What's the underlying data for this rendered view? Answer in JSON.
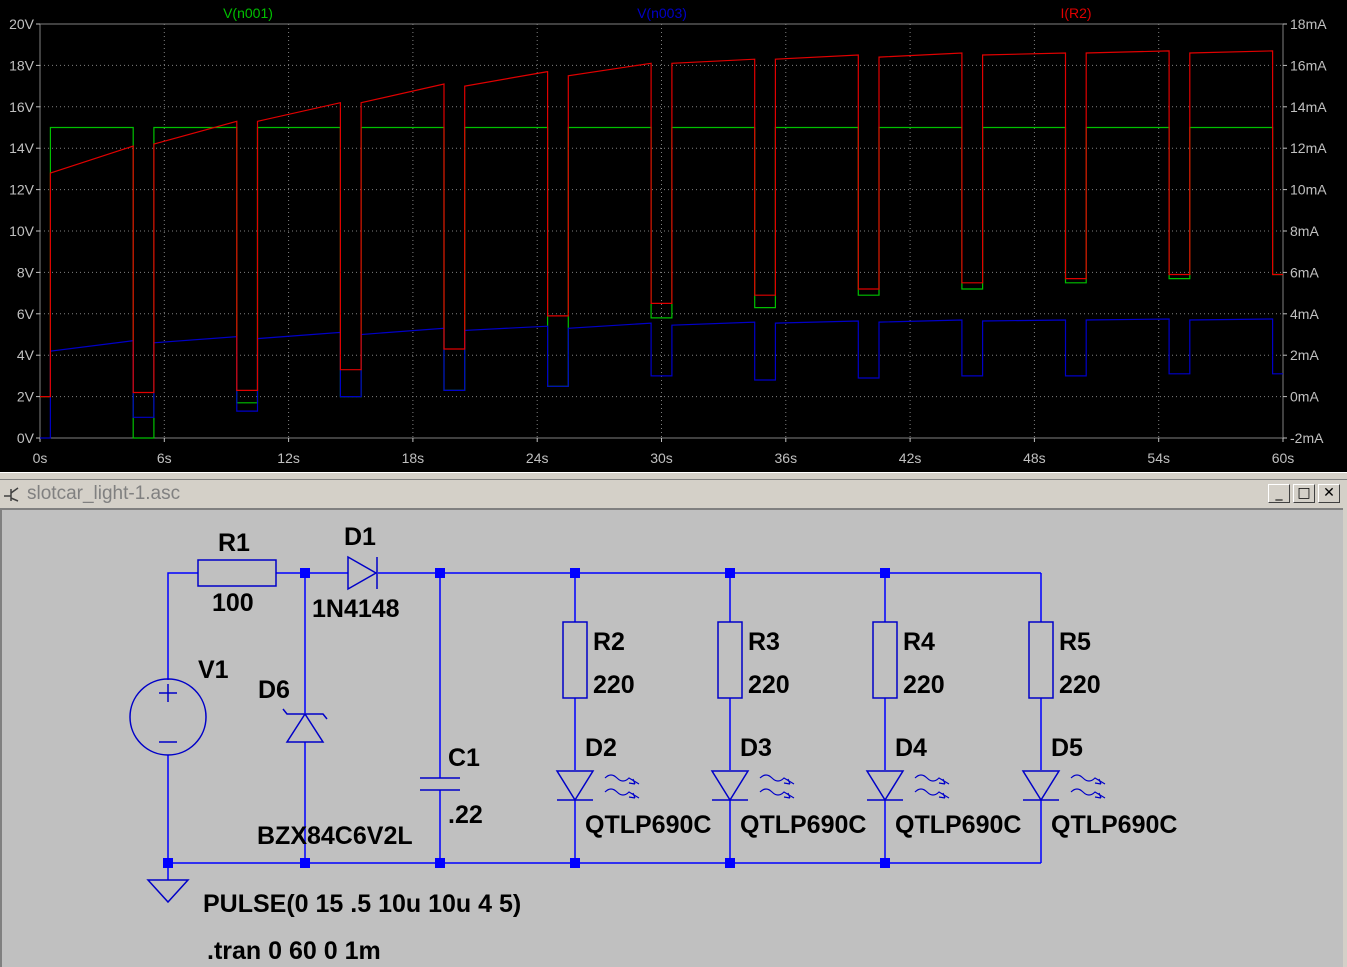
{
  "plot": {
    "traces": [
      {
        "name": "V(n001)",
        "color": "#00c000"
      },
      {
        "name": "V(n003)",
        "color": "#0000c8"
      },
      {
        "name": "I(R2)",
        "color": "#e00000"
      }
    ],
    "x_ticks": [
      "0s",
      "6s",
      "12s",
      "18s",
      "24s",
      "30s",
      "36s",
      "42s",
      "48s",
      "54s",
      "60s"
    ],
    "y_left_ticks": [
      "20V",
      "18V",
      "16V",
      "14V",
      "12V",
      "10V",
      "8V",
      "6V",
      "4V",
      "2V",
      "0V"
    ],
    "y_right_ticks": [
      "18mA",
      "16mA",
      "14mA",
      "12mA",
      "10mA",
      "8mA",
      "6mA",
      "4mA",
      "2mA",
      "0mA",
      "-2mA"
    ],
    "x_range": [
      0,
      60
    ],
    "y_left_range": [
      0,
      20
    ],
    "y_right_range": [
      -2,
      18
    ]
  },
  "chart_data": {
    "type": "line",
    "x_range": [
      0,
      60
    ],
    "ylim": [
      0,
      20
    ],
    "y2lim": [
      -2,
      18
    ],
    "pulse": {
      "v1": 0,
      "v2": 15,
      "delay": 0.5,
      "rise": 1e-05,
      "fall": 1e-05,
      "on": 4,
      "period": 5
    },
    "series": [
      {
        "name": "V(n001)",
        "axis": "left",
        "points": [
          [
            0,
            2
          ],
          [
            0.5,
            2
          ],
          [
            0.5,
            15
          ],
          [
            4.5,
            15
          ],
          [
            4.5,
            0
          ],
          [
            5.5,
            0
          ],
          [
            5.5,
            1
          ],
          [
            5.5,
            15
          ],
          [
            9.5,
            15
          ],
          [
            9.5,
            1.7
          ],
          [
            10.5,
            1.7
          ],
          [
            10.5,
            15
          ],
          [
            14.5,
            15
          ],
          [
            14.5,
            2
          ],
          [
            15.5,
            2
          ],
          [
            15.5,
            15
          ],
          [
            19.5,
            15
          ],
          [
            19.5,
            2.3
          ],
          [
            20.5,
            2.3
          ],
          [
            20.5,
            15
          ],
          [
            24.5,
            15
          ],
          [
            24.5,
            2.5
          ],
          [
            25.5,
            2.5
          ],
          [
            25.5,
            15
          ],
          [
            29.5,
            15
          ],
          [
            29.5,
            5.8
          ],
          [
            30.5,
            5.8
          ],
          [
            30.5,
            15
          ],
          [
            34.5,
            15
          ],
          [
            34.5,
            6.3
          ],
          [
            35.5,
            6.3
          ],
          [
            35.5,
            15
          ],
          [
            39.5,
            15
          ],
          [
            39.5,
            6.9
          ],
          [
            40.5,
            6.9
          ],
          [
            40.5,
            15
          ],
          [
            44.5,
            15
          ],
          [
            44.5,
            7.2
          ],
          [
            45.5,
            7.2
          ],
          [
            45.5,
            15
          ],
          [
            49.5,
            15
          ],
          [
            49.5,
            7.5
          ],
          [
            50.5,
            7.5
          ],
          [
            50.5,
            15
          ],
          [
            54.5,
            15
          ],
          [
            54.5,
            7.7
          ],
          [
            55.5,
            7.7
          ],
          [
            55.5,
            15
          ],
          [
            59.5,
            15
          ],
          [
            59.5,
            7.9
          ],
          [
            60,
            7.9
          ]
        ]
      },
      {
        "name": "V(n003)",
        "axis": "left",
        "points": [
          [
            0.5,
            4.2
          ],
          [
            4.5,
            4.7
          ],
          [
            5.5,
            4.6
          ],
          [
            9.5,
            4.9
          ],
          [
            10.5,
            4.8
          ],
          [
            14.5,
            5.1
          ],
          [
            15.5,
            5.0
          ],
          [
            19.5,
            5.3
          ],
          [
            20.5,
            5.2
          ],
          [
            24.5,
            5.4
          ],
          [
            25.5,
            5.3
          ],
          [
            29.5,
            5.55
          ],
          [
            30.5,
            5.45
          ],
          [
            34.5,
            5.6
          ],
          [
            35.5,
            5.55
          ],
          [
            39.5,
            5.65
          ],
          [
            40.5,
            5.6
          ],
          [
            44.5,
            5.7
          ],
          [
            45.5,
            5.65
          ],
          [
            49.5,
            5.7
          ],
          [
            50.5,
            5.7
          ],
          [
            54.5,
            5.75
          ],
          [
            55.5,
            5.7
          ],
          [
            59.5,
            5.75
          ]
        ]
      },
      {
        "name": "I(R2)",
        "axis": "right",
        "points": [
          [
            0.5,
            10.8
          ],
          [
            4.5,
            12.1
          ],
          [
            5.5,
            12.2
          ],
          [
            9.5,
            13.3
          ],
          [
            10.5,
            13.3
          ],
          [
            14.5,
            14.2
          ],
          [
            15.5,
            14.2
          ],
          [
            19.5,
            15.1
          ],
          [
            20.5,
            15.0
          ],
          [
            24.5,
            15.7
          ],
          [
            25.5,
            15.5
          ],
          [
            29.5,
            16.1
          ],
          [
            30.5,
            16.1
          ],
          [
            34.5,
            16.3
          ],
          [
            35.5,
            16.3
          ],
          [
            39.5,
            16.5
          ],
          [
            40.5,
            16.4
          ],
          [
            44.5,
            16.6
          ],
          [
            45.5,
            16.5
          ],
          [
            49.5,
            16.6
          ],
          [
            50.5,
            16.6
          ],
          [
            54.5,
            16.7
          ],
          [
            55.5,
            16.6
          ],
          [
            59.5,
            16.7
          ]
        ]
      }
    ]
  },
  "window": {
    "title": "slotcar_light-1.asc",
    "minimize": "_",
    "maximize": "□",
    "close": "✕"
  },
  "schematic": {
    "R1": {
      "name": "R1",
      "value": "100"
    },
    "D1": {
      "name": "D1",
      "value": "1N4148"
    },
    "V1": {
      "name": "V1"
    },
    "D6": {
      "name": "D6",
      "value": "BZX84C6V2L"
    },
    "C1": {
      "name": "C1",
      "value": ".22"
    },
    "R2": {
      "name": "R2",
      "value": "220"
    },
    "R3": {
      "name": "R3",
      "value": "220"
    },
    "R4": {
      "name": "R4",
      "value": "220"
    },
    "R5": {
      "name": "R5",
      "value": "220"
    },
    "D2": {
      "name": "D2",
      "value": "QTLP690C"
    },
    "D3": {
      "name": "D3",
      "value": "QTLP690C"
    },
    "D4": {
      "name": "D4",
      "value": "QTLP690C"
    },
    "D5": {
      "name": "D5",
      "value": "QTLP690C"
    },
    "source_spec": "PULSE(0 15 .5 10u 10u 4 5)",
    "directive": ".tran 0 60 0 1m"
  },
  "colors": {
    "wire": "#0000ff",
    "component": "#0000c8",
    "grid": "#808080",
    "plot_bg": "#000000",
    "schem_bg": "#c0c0c0"
  }
}
